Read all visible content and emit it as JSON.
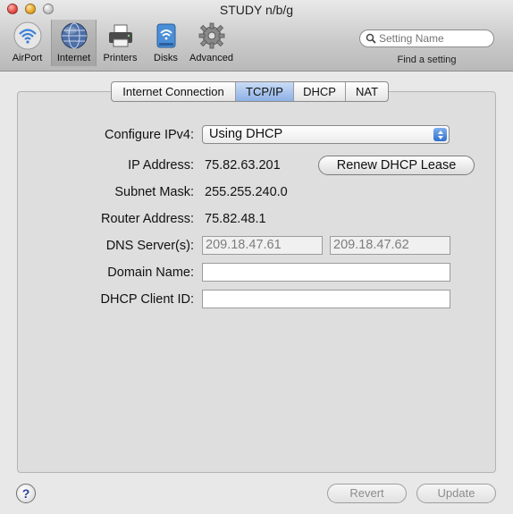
{
  "window": {
    "title": "STUDY n/b/g"
  },
  "toolbar": {
    "items": [
      {
        "label": "AirPort",
        "icon": "airport-icon"
      },
      {
        "label": "Internet",
        "icon": "internet-globe-icon",
        "selected": true
      },
      {
        "label": "Printers",
        "icon": "printer-icon"
      },
      {
        "label": "Disks",
        "icon": "disk-icon"
      },
      {
        "label": "Advanced",
        "icon": "gear-icon"
      }
    ],
    "search_placeholder": "Setting Name",
    "search_caption": "Find a setting"
  },
  "tabs": [
    {
      "label": "Internet Connection",
      "active": false
    },
    {
      "label": "TCP/IP",
      "active": true
    },
    {
      "label": "DHCP",
      "active": false
    },
    {
      "label": "NAT",
      "active": false
    }
  ],
  "tcpip": {
    "configure_label": "Configure IPv4:",
    "configure_value": "Using DHCP",
    "ip_label": "IP Address:",
    "ip_value": "75.82.63.201",
    "renew_button": "Renew DHCP Lease",
    "subnet_label": "Subnet Mask:",
    "subnet_value": "255.255.240.0",
    "router_label": "Router Address:",
    "router_value": "75.82.48.1",
    "dns_label": "DNS Server(s):",
    "dns_primary": "209.18.47.61",
    "dns_secondary": "209.18.47.62",
    "domain_label": "Domain Name:",
    "domain_value": "",
    "client_id_label": "DHCP Client ID:",
    "client_id_value": ""
  },
  "footer": {
    "help_label": "?",
    "revert_label": "Revert",
    "update_label": "Update"
  },
  "colors": {
    "accent_blue": "#8db1e6",
    "close": "#e0443e",
    "minimize": "#e2a11f"
  }
}
